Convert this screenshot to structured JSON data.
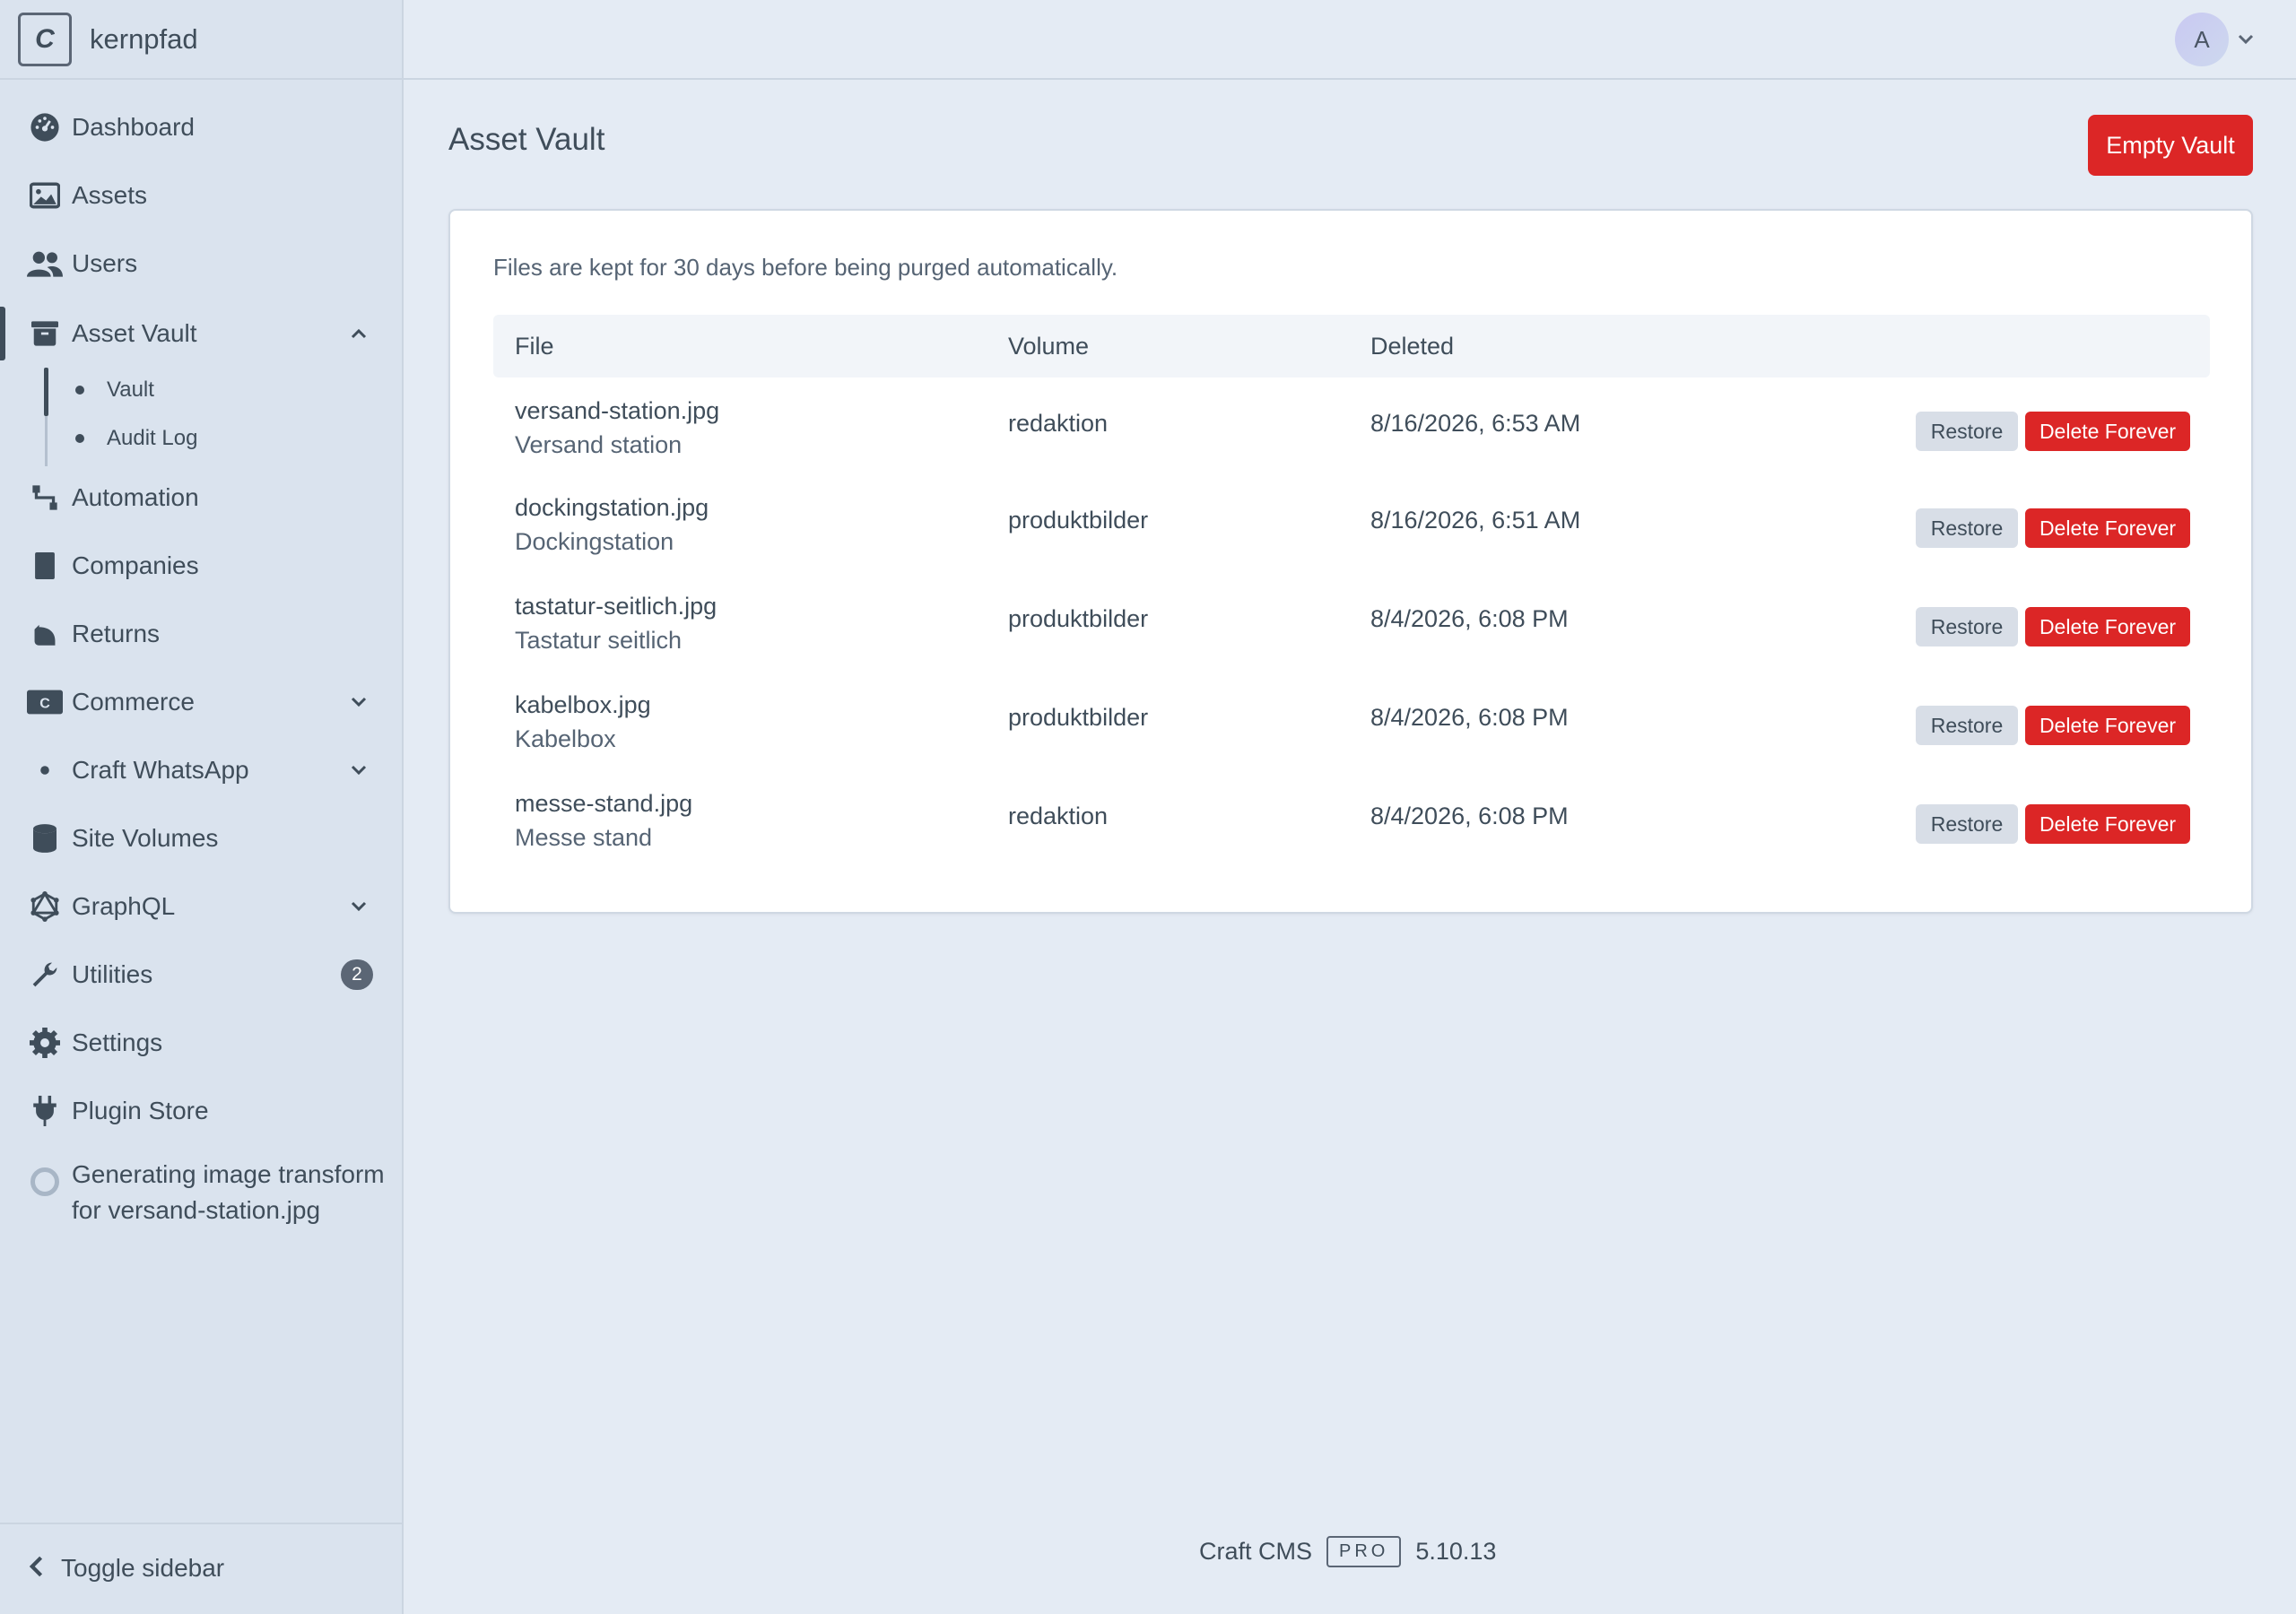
{
  "app": {
    "logo_letter": "C",
    "site_name": "kernpfad"
  },
  "sidebar": {
    "items": [
      {
        "label": "Dashboard",
        "icon": "dashboard-icon"
      },
      {
        "label": "Assets",
        "icon": "image-icon"
      },
      {
        "label": "Users",
        "icon": "users-icon"
      },
      {
        "label": "Asset Vault",
        "icon": "archive-icon",
        "expanded": true,
        "active": true
      },
      {
        "label": "Automation",
        "icon": "flow-icon"
      },
      {
        "label": "Companies",
        "icon": "building-icon"
      },
      {
        "label": "Returns",
        "icon": "return-icon"
      },
      {
        "label": "Commerce",
        "icon": "commerce-icon",
        "expanded": false
      },
      {
        "label": "Craft WhatsApp",
        "icon": "bullet-icon",
        "expanded": false
      },
      {
        "label": "Site Volumes",
        "icon": "database-icon"
      },
      {
        "label": "GraphQL",
        "icon": "graphql-icon",
        "expanded": false
      },
      {
        "label": "Utilities",
        "icon": "wrench-icon",
        "badge": "2"
      },
      {
        "label": "Settings",
        "icon": "gear-icon"
      },
      {
        "label": "Plugin Store",
        "icon": "plug-icon"
      }
    ],
    "subitems": [
      {
        "label": "Vault",
        "active": true
      },
      {
        "label": "Audit Log",
        "active": false
      }
    ],
    "job": {
      "label": "Generating image transform for versand-station.jpg"
    },
    "toggle_label": "Toggle sidebar"
  },
  "header": {
    "avatar_initial": "A"
  },
  "main": {
    "title": "Asset Vault",
    "empty_button": "Empty Vault",
    "note": "Files are kept for 30 days before being purged automatically.",
    "columns": [
      "File",
      "Volume",
      "Deleted"
    ],
    "restore_label": "Restore",
    "delete_label": "Delete Forever",
    "rows": [
      {
        "file": "versand-station.jpg",
        "title": "Versand station",
        "volume": "redaktion",
        "deleted": "8/16/2026, 6:53 AM"
      },
      {
        "file": "dockingstation.jpg",
        "title": "Dockingstation",
        "volume": "produktbilder",
        "deleted": "8/16/2026, 6:51 AM"
      },
      {
        "file": "tastatur-seitlich.jpg",
        "title": "Tastatur seitlich",
        "volume": "produktbilder",
        "deleted": "8/4/2026, 6:08 PM"
      },
      {
        "file": "kabelbox.jpg",
        "title": "Kabelbox",
        "volume": "produktbilder",
        "deleted": "8/4/2026, 6:08 PM"
      },
      {
        "file": "messe-stand.jpg",
        "title": "Messe stand",
        "volume": "redaktion",
        "deleted": "8/4/2026, 6:08 PM"
      }
    ]
  },
  "footer": {
    "product": "Craft CMS",
    "edition": "PRO",
    "version": "5.10.13"
  },
  "colors": {
    "accent_danger": "#dc2626",
    "sidebar_bg": "#dae3ee",
    "page_bg": "#e4ebf4",
    "text": "#3f4d5a"
  }
}
